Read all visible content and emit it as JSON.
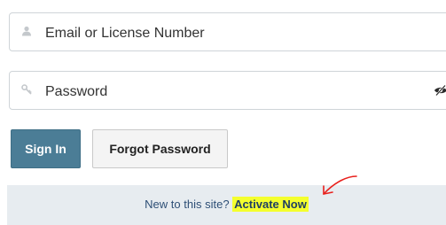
{
  "login": {
    "email_placeholder": "Email or License Number",
    "password_placeholder": "Password",
    "sign_in_label": "Sign In",
    "forgot_password_label": "Forgot Password"
  },
  "footer": {
    "prompt_text": "New to this site?",
    "activate_label": "Activate Now"
  },
  "icons": {
    "email": "person-icon",
    "password": "key-icon",
    "show_password": "eye-slash-icon",
    "annotation": "red-hand-drawn-arrow"
  },
  "colors": {
    "primary_button": "#4b7d96",
    "banner_bg": "#e7ecf0",
    "highlight": "#f4ff2e",
    "annotation_arrow": "#e8201c"
  }
}
